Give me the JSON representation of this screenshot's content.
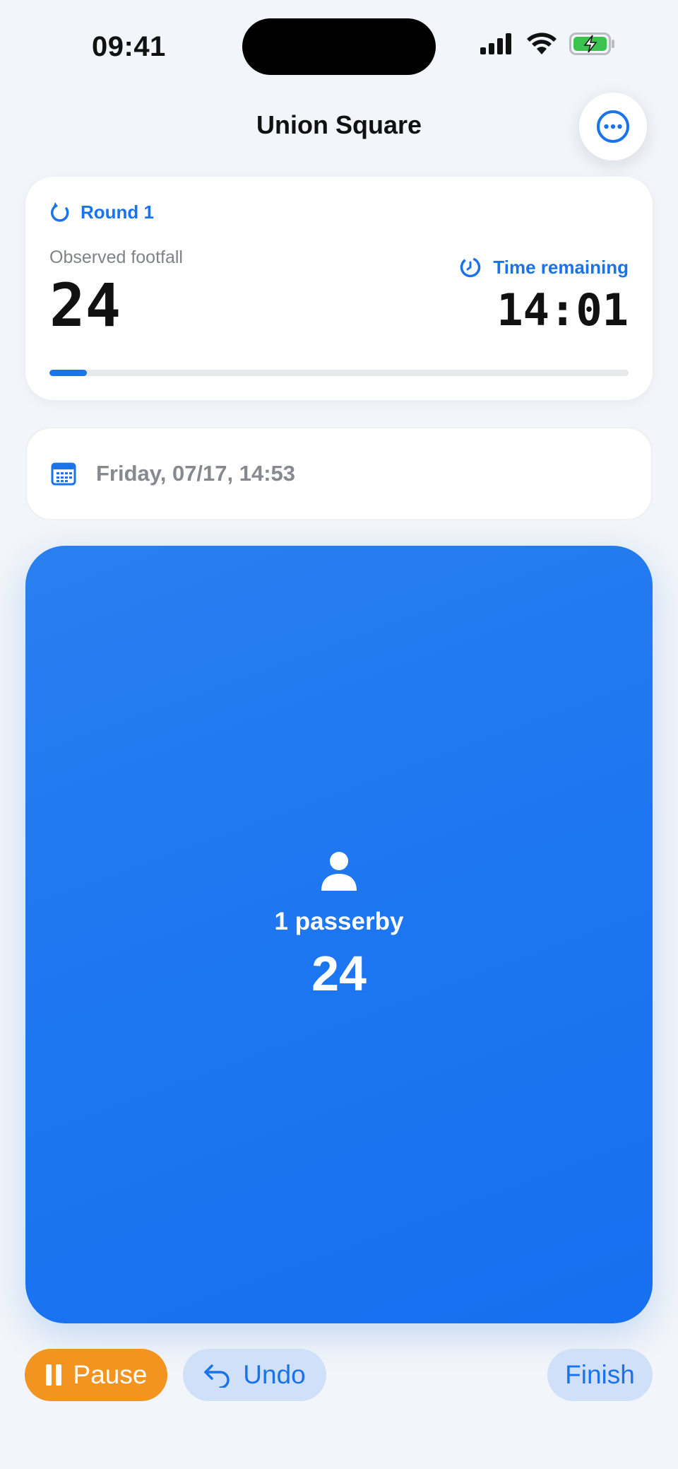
{
  "status_bar": {
    "time": "09:41",
    "icons": [
      "cellular-signal-icon",
      "wifi-icon",
      "battery-charging-icon"
    ]
  },
  "header": {
    "title": "Union Square",
    "menu_icon": "ellipsis-circle-icon"
  },
  "session": {
    "round_label": "Round 1",
    "round_icon": "refresh-icon",
    "footfall_label": "Observed footfall",
    "footfall_value": "24",
    "time_remaining_label": "Time remaining",
    "time_remaining_icon": "timer-icon",
    "time_remaining_value": "14:01",
    "progress_fraction": 0.065
  },
  "date": {
    "icon": "calendar-icon",
    "text": "Friday, 07/17, 14:53"
  },
  "tap_area": {
    "icon": "person-icon",
    "label": "1 passerby",
    "count": "24"
  },
  "controls": {
    "pause_label": "Pause",
    "undo_label": "Undo",
    "finish_label": "Finish"
  },
  "colors": {
    "accent": "#1a73e8",
    "tap_area": "#1d76f1",
    "pause": "#f39420",
    "secondary_button": "#cfe0f8",
    "background": "#f2f5f9"
  }
}
